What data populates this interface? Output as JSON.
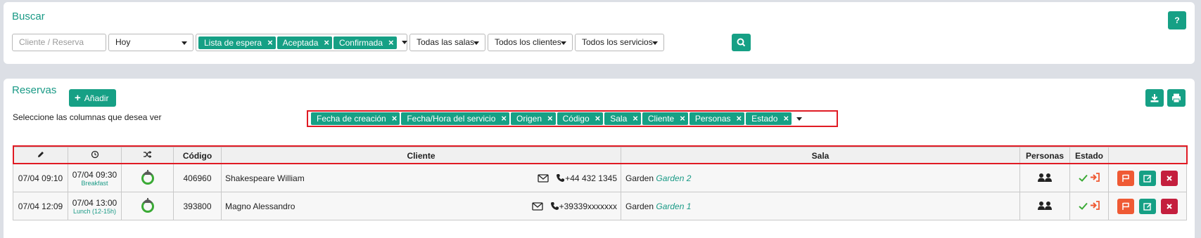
{
  "search": {
    "title": "Buscar",
    "help_label": "?",
    "client_placeholder": "Cliente  / Reserva",
    "date_value": "Hoy",
    "status_tags": [
      "Lista de espera",
      "Aceptada",
      "Confirmada"
    ],
    "rooms_value": "Todas las salas",
    "clients_value": "Todos los clientes",
    "services_value": "Todos los servicios"
  },
  "reservations": {
    "title": "Reservas",
    "add_label": "Añadir",
    "columns_label": "Seleccione las columnas que desea ver",
    "column_tags": [
      "Fecha de creación",
      "Fecha/Hora del servicio",
      "Origen",
      "Código",
      "Sala",
      "Cliente",
      "Personas",
      "Estado"
    ],
    "headers": {
      "code": "Código",
      "client": "Cliente",
      "room": "Sala",
      "people": "Personas",
      "status": "Estado"
    },
    "rows": [
      {
        "created": "07/04 09:10",
        "service_time": "07/04 09:30",
        "service_name": "Breakfast",
        "code": "406960",
        "client": "Shakespeare William",
        "phone": "+44 432 1345",
        "room": "Garden",
        "zone": "Garden 2"
      },
      {
        "created": "07/04 12:09",
        "service_time": "07/04 13:00",
        "service_name": "Lunch (12-15h)",
        "code": "393800",
        "client": "Magno Alessandro",
        "phone": "+39339xxxxxxx",
        "room": "Garden",
        "zone": "Garden 1"
      }
    ]
  },
  "colors": {
    "accent": "#16a085",
    "accent_text": "#1a9a86",
    "highlight_border": "#e01b24",
    "flag_button": "#ef5a34",
    "delete_button": "#c41f3e"
  }
}
